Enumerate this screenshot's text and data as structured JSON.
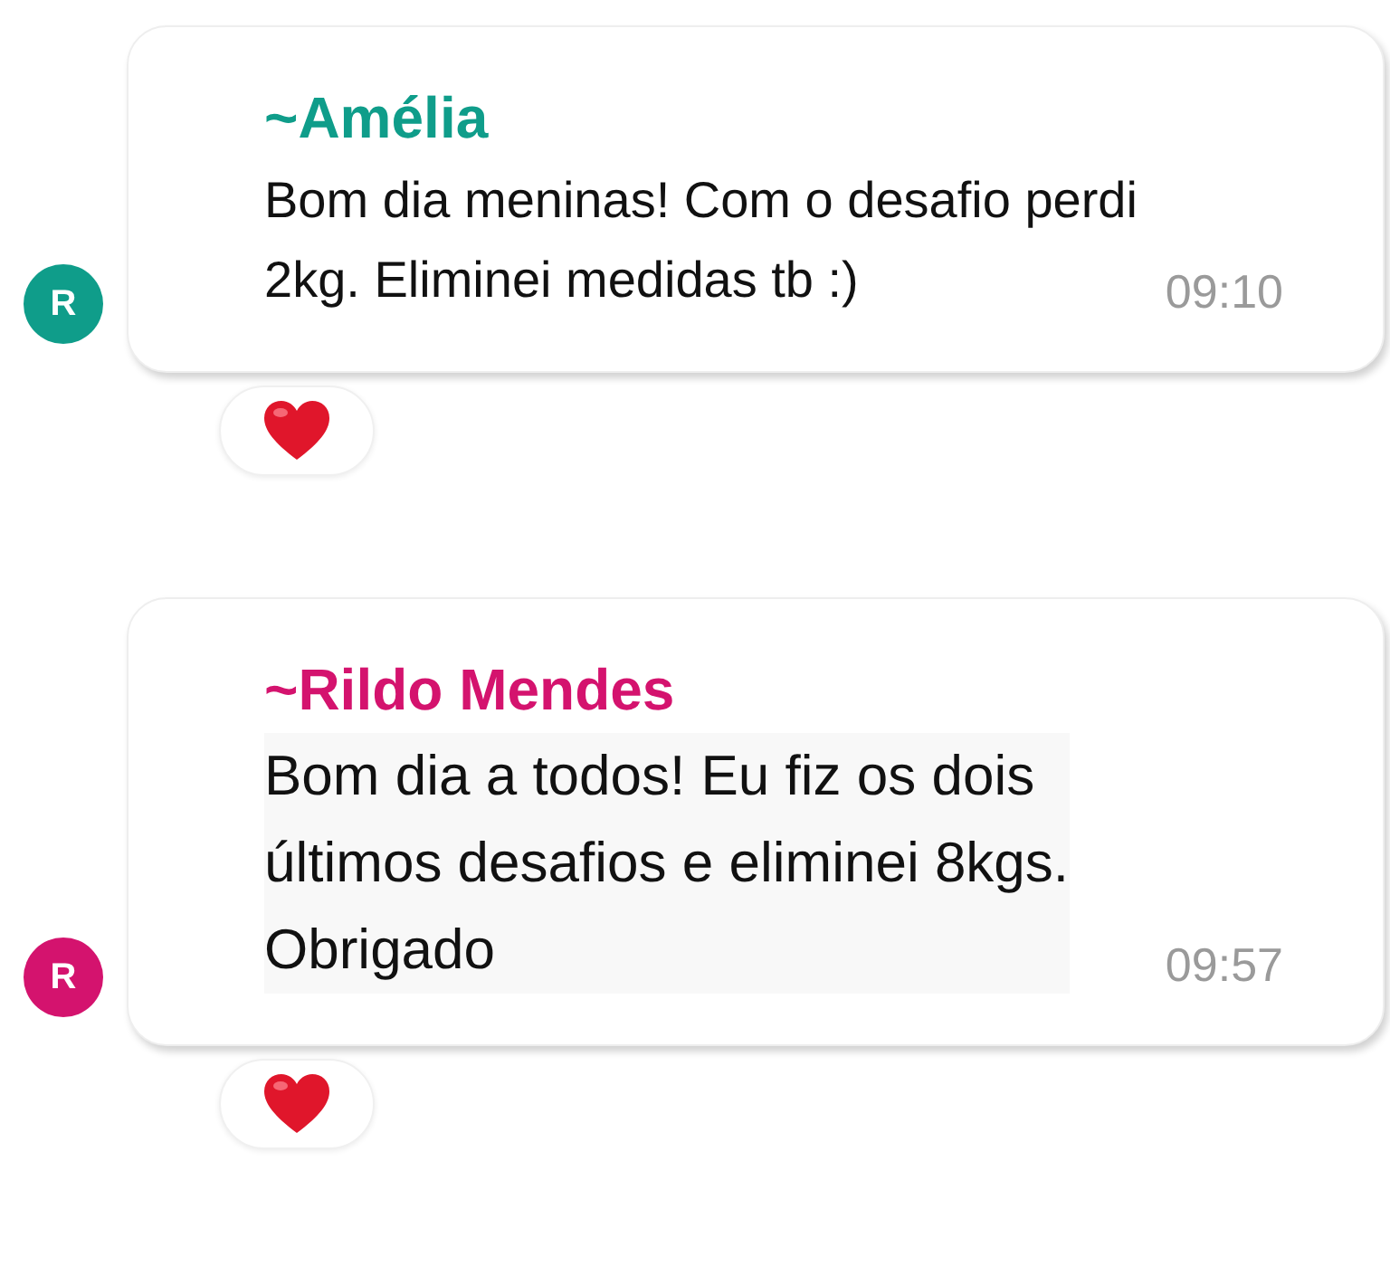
{
  "messages": [
    {
      "sender": "~Amélia",
      "color": "#0f9d8a",
      "avatar": "R",
      "lines": [
        "Bom dia meninas! Com o desafio perdi",
        "2kg. Eliminei medidas tb :)"
      ],
      "time": "09:10",
      "reaction": {
        "kind": "heart"
      }
    },
    {
      "sender": "~Rildo Mendes",
      "color": "#d4136e",
      "avatar": "R",
      "lines": [
        "Bom dia a todos! Eu fiz os dois",
        "últimos desafios e eliminei 8kgs.",
        "Obrigado"
      ],
      "time": "09:57",
      "reaction": {
        "kind": "heart"
      }
    }
  ]
}
